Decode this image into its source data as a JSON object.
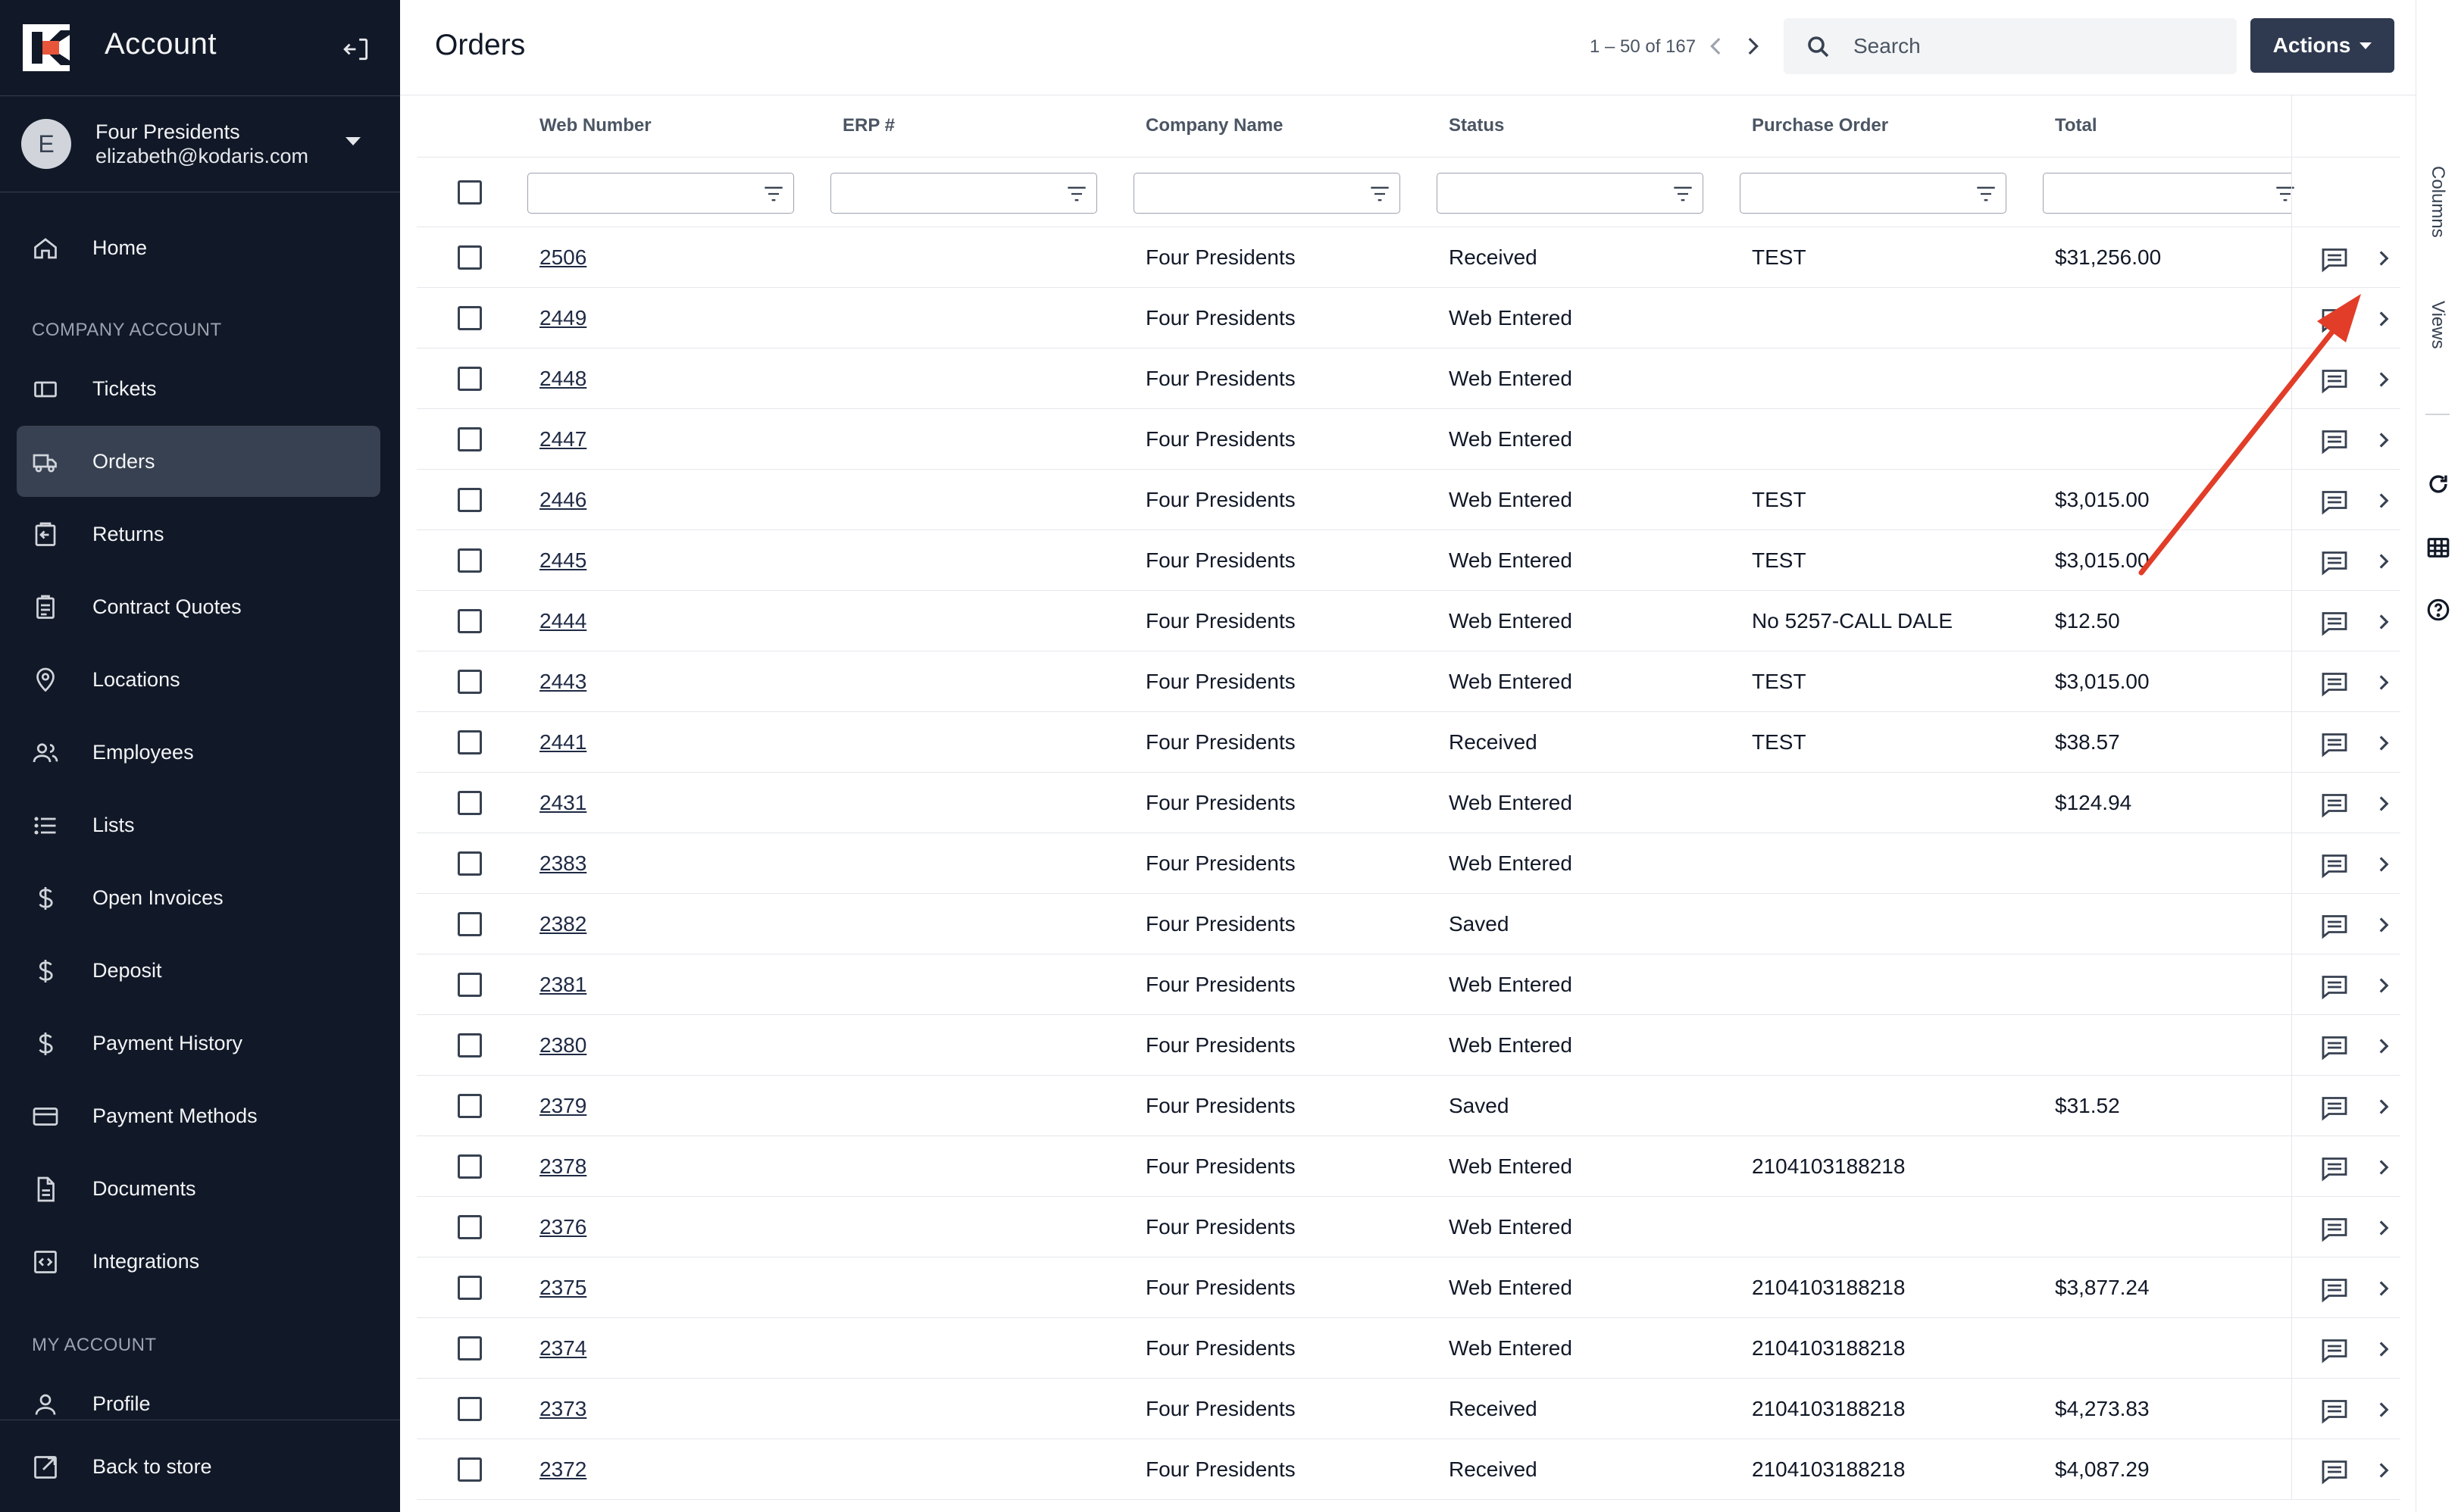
{
  "sidebar": {
    "brand_title": "Account",
    "user": {
      "initial": "E",
      "name": "Four Presidents",
      "email": "elizabeth@kodaris.com"
    },
    "home_label": "Home",
    "section_company": "COMPANY ACCOUNT",
    "company_items": [
      {
        "label": "Tickets",
        "icon": "ticket-icon"
      },
      {
        "label": "Orders",
        "icon": "truck-icon",
        "active": true
      },
      {
        "label": "Returns",
        "icon": "return-icon"
      },
      {
        "label": "Contract Quotes",
        "icon": "clipboard-icon"
      },
      {
        "label": "Locations",
        "icon": "map-pin-icon"
      },
      {
        "label": "Employees",
        "icon": "users-icon"
      },
      {
        "label": "Lists",
        "icon": "list-icon"
      },
      {
        "label": "Open Invoices",
        "icon": "dollar-icon"
      },
      {
        "label": "Deposit",
        "icon": "dollar-icon"
      },
      {
        "label": "Payment History",
        "icon": "dollar-icon"
      },
      {
        "label": "Payment Methods",
        "icon": "credit-card-icon"
      },
      {
        "label": "Documents",
        "icon": "document-icon"
      },
      {
        "label": "Integrations",
        "icon": "code-icon"
      }
    ],
    "section_my": "MY ACCOUNT",
    "profile_label": "Profile",
    "back_label": "Back to store"
  },
  "topbar": {
    "title": "Orders",
    "pager": "1 – 50 of 167",
    "search_placeholder": "Search",
    "actions_label": "Actions"
  },
  "table": {
    "columns": [
      "Web Number",
      "ERP #",
      "Company Name",
      "Status",
      "Purchase Order",
      "Total"
    ],
    "rows": [
      {
        "web": "2506",
        "erp": "",
        "company": "Four Presidents",
        "status": "Received",
        "po": "TEST",
        "total": "$31,256.00"
      },
      {
        "web": "2449",
        "erp": "",
        "company": "Four Presidents",
        "status": "Web Entered",
        "po": "",
        "total": ""
      },
      {
        "web": "2448",
        "erp": "",
        "company": "Four Presidents",
        "status": "Web Entered",
        "po": "",
        "total": ""
      },
      {
        "web": "2447",
        "erp": "",
        "company": "Four Presidents",
        "status": "Web Entered",
        "po": "",
        "total": ""
      },
      {
        "web": "2446",
        "erp": "",
        "company": "Four Presidents",
        "status": "Web Entered",
        "po": "TEST",
        "total": "$3,015.00"
      },
      {
        "web": "2445",
        "erp": "",
        "company": "Four Presidents",
        "status": "Web Entered",
        "po": "TEST",
        "total": "$3,015.00"
      },
      {
        "web": "2444",
        "erp": "",
        "company": "Four Presidents",
        "status": "Web Entered",
        "po": "No 5257-CALL DALE",
        "total": "$12.50"
      },
      {
        "web": "2443",
        "erp": "",
        "company": "Four Presidents",
        "status": "Web Entered",
        "po": "TEST",
        "total": "$3,015.00"
      },
      {
        "web": "2441",
        "erp": "",
        "company": "Four Presidents",
        "status": "Received",
        "po": "TEST",
        "total": "$38.57"
      },
      {
        "web": "2431",
        "erp": "",
        "company": "Four Presidents",
        "status": "Web Entered",
        "po": "",
        "total": "$124.94"
      },
      {
        "web": "2383",
        "erp": "",
        "company": "Four Presidents",
        "status": "Web Entered",
        "po": "",
        "total": ""
      },
      {
        "web": "2382",
        "erp": "",
        "company": "Four Presidents",
        "status": "Saved",
        "po": "",
        "total": ""
      },
      {
        "web": "2381",
        "erp": "",
        "company": "Four Presidents",
        "status": "Web Entered",
        "po": "",
        "total": ""
      },
      {
        "web": "2380",
        "erp": "",
        "company": "Four Presidents",
        "status": "Web Entered",
        "po": "",
        "total": ""
      },
      {
        "web": "2379",
        "erp": "",
        "company": "Four Presidents",
        "status": "Saved",
        "po": "",
        "total": "$31.52"
      },
      {
        "web": "2378",
        "erp": "",
        "company": "Four Presidents",
        "status": "Web Entered",
        "po": "2104103188218",
        "total": ""
      },
      {
        "web": "2376",
        "erp": "",
        "company": "Four Presidents",
        "status": "Web Entered",
        "po": "",
        "total": ""
      },
      {
        "web": "2375",
        "erp": "",
        "company": "Four Presidents",
        "status": "Web Entered",
        "po": "2104103188218",
        "total": "$3,877.24"
      },
      {
        "web": "2374",
        "erp": "",
        "company": "Four Presidents",
        "status": "Web Entered",
        "po": "2104103188218",
        "total": ""
      },
      {
        "web": "2373",
        "erp": "",
        "company": "Four Presidents",
        "status": "Received",
        "po": "2104103188218",
        "total": "$4,273.83"
      },
      {
        "web": "2372",
        "erp": "",
        "company": "Four Presidents",
        "status": "Received",
        "po": "2104103188218",
        "total": "$4,087.29"
      }
    ]
  },
  "toolstrip": {
    "columns_label": "Columns",
    "views_label": "Views",
    "icons": [
      "refresh-icon",
      "grid-icon",
      "help-icon"
    ]
  },
  "colors": {
    "sidebar_bg": "#111827",
    "active_nav": "#374151",
    "accent_brand": "#e8553a",
    "actions_bg": "#2f3a50",
    "annotation_arrow": "#e23d28"
  }
}
